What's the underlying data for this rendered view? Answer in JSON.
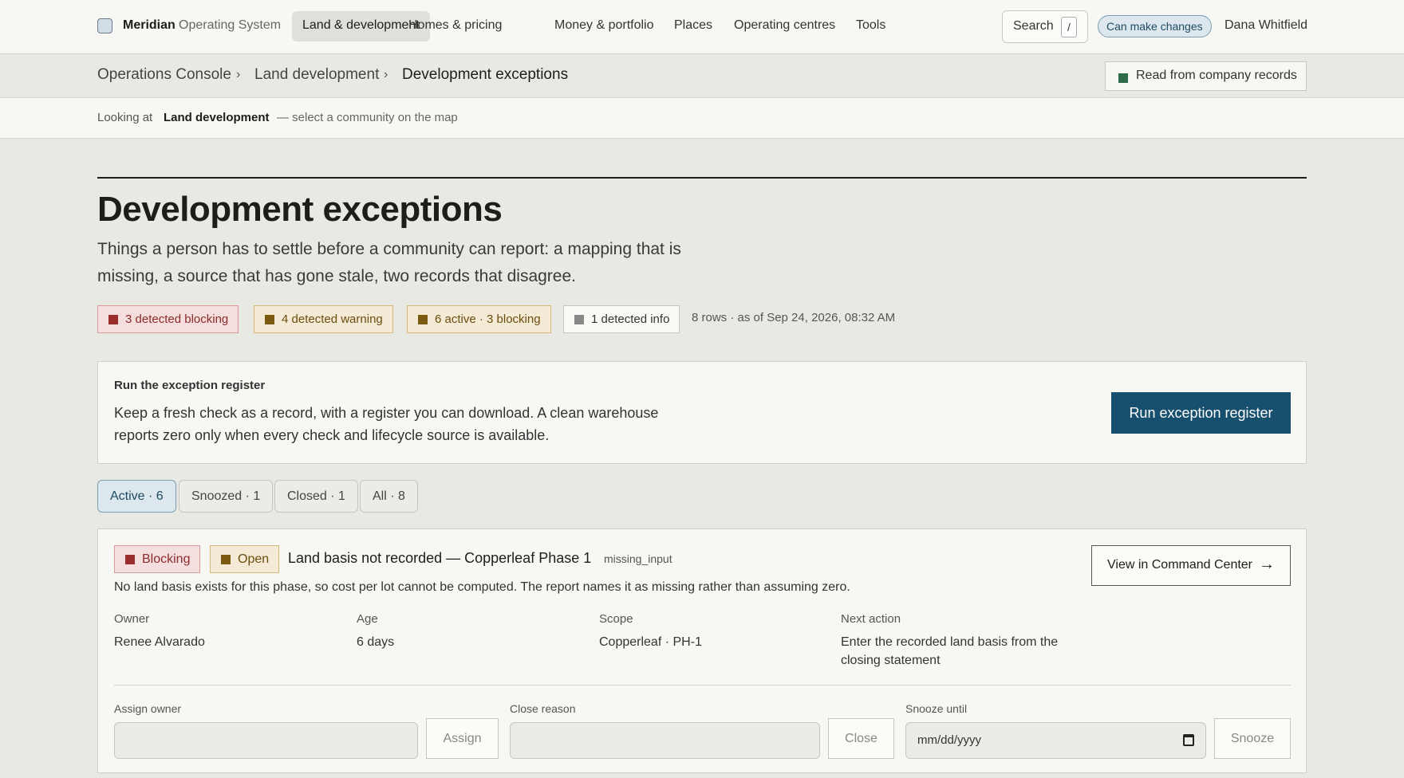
{
  "header": {
    "brand": "Meridian",
    "brand_sub": "Operating System",
    "nav": [
      "Land & development",
      "Homes & pricing",
      "Money & portfolio",
      "Places",
      "Operating centres",
      "Tools"
    ],
    "search_label": "Search",
    "search_key": "/",
    "permission": "Can make changes",
    "user": "Dana Whitfield"
  },
  "breadcrumb": {
    "items": [
      "Operations Console",
      "Land development",
      "Development exceptions"
    ],
    "separator": "›",
    "source": "Read from company records",
    "source_color": "#2e6b4a"
  },
  "context": {
    "prefix": "Looking at",
    "value": "Land development",
    "hint": "— select a community on the map"
  },
  "page": {
    "title": "Development exceptions",
    "description": "Things a person has to settle before a community can report: a mapping that is missing, a source that has gone stale, two records that disagree.",
    "chips": [
      "3 detected blocking",
      "4 detected warning",
      "6 active · 3 blocking",
      "1 detected info"
    ],
    "rows_meta": "8 rows · as of Sep 24, 2026, 08:32 AM"
  },
  "run_panel": {
    "title": "Run the exception register",
    "description": "Keep a fresh check as a record, with a register you can download. A clean warehouse reports zero only when every check and lifecycle source is available.",
    "button": "Run exception register",
    "button_color": "#174f6e"
  },
  "tabs": [
    "Active · 6",
    "Snoozed · 1",
    "Closed · 1",
    "All · 8"
  ],
  "exception": {
    "severity": "Blocking",
    "status": "Open",
    "title": "Land basis not recorded — Copperleaf Phase 1",
    "code": "missing_input",
    "cta": "View in Command Center",
    "description": "No land basis exists for this phase, so cost per lot cannot be computed. The report names it as missing rather than assuming zero.",
    "fields": [
      {
        "label": "Owner",
        "value": "Renee Alvarado"
      },
      {
        "label": "Age",
        "value": "6 days"
      },
      {
        "label": "Scope",
        "value": "Copperleaf · PH-1"
      },
      {
        "label": "Next action",
        "value": "Enter the recorded land basis from the closing statement"
      }
    ],
    "form": {
      "assign_label": "Assign owner",
      "assign_value": "",
      "assign_button": "Assign",
      "close_label": "Close reason",
      "close_value": "",
      "close_button": "Close",
      "snooze_label": "Snooze until",
      "snooze_placeholder": "mm/dd/yyyy",
      "snooze_button": "Snooze"
    }
  },
  "colors": {
    "blocking": "#9b2d2d",
    "warning": "#7c5a12",
    "info": "#888888",
    "accent": "#174f6e"
  }
}
